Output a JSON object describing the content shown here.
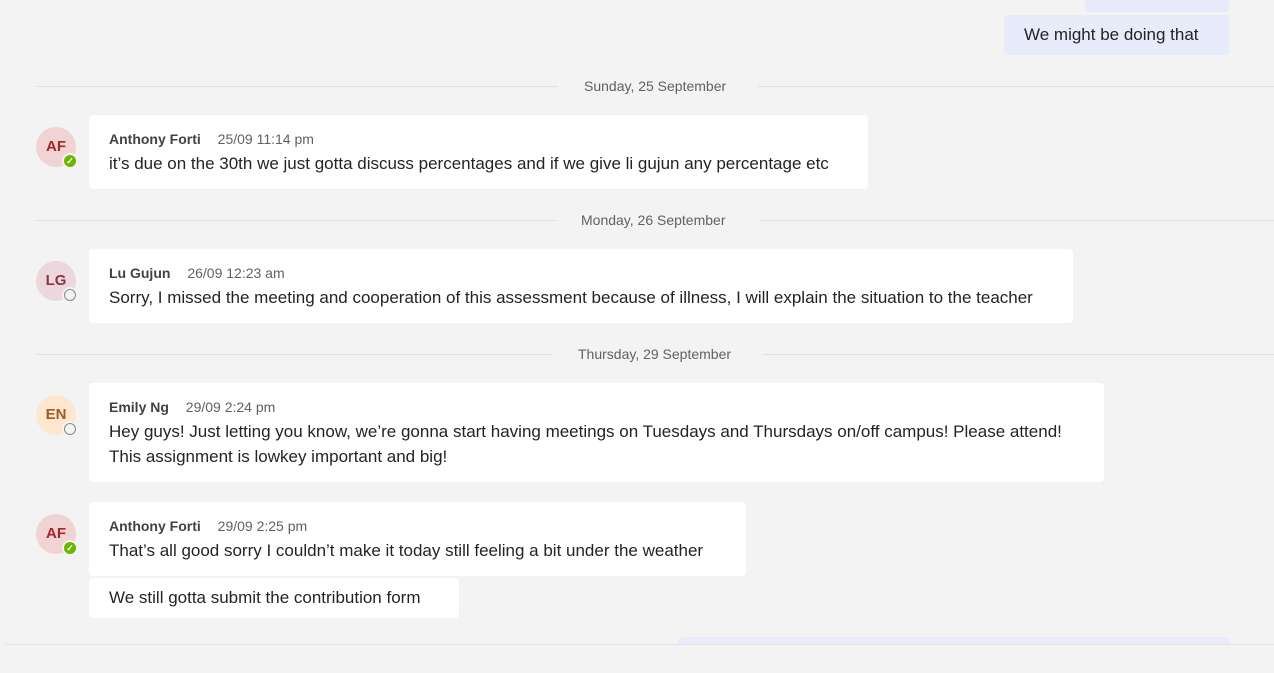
{
  "own_messages": {
    "top_message": "We might be doing that"
  },
  "date_dividers": [
    "Sunday, 25 September",
    "Monday, 26 September",
    "Thursday, 29 September"
  ],
  "messages": [
    {
      "initials": "AF",
      "author": "Anthony Forti",
      "timestamp": "25/09 11:14 pm",
      "status": "available",
      "lines": [
        "it’s due on the 30th we just gotta discuss percentages and if we give li gujun any percentage etc"
      ]
    },
    {
      "initials": "LG",
      "author": "Lu Gujun",
      "timestamp": "26/09 12:23 am",
      "status": "offline",
      "lines": [
        "Sorry, I missed the meeting and cooperation of this assessment because of illness, I will explain the situation to the teacher"
      ]
    },
    {
      "initials": "EN",
      "author": "Emily Ng",
      "timestamp": "29/09 2:24 pm",
      "status": "offline",
      "lines": [
        "Hey guys! Just letting you know, we’re gonna start having meetings on Tuesdays and Thursdays on/off campus! Please attend!",
        "This assignment is lowkey important and big!"
      ]
    },
    {
      "initials": "AF",
      "author": "Anthony Forti",
      "timestamp": "29/09 2:25 pm",
      "status": "available",
      "lines": [
        "That’s all good sorry I couldn’t make it today still feeling a bit under the weather"
      ],
      "followup": "We still gotta submit the contribution form"
    }
  ],
  "colors": {
    "background": "#f3f3f3",
    "bubble_other": "#ffffff",
    "bubble_self": "#e8ebfa",
    "status_available": "#6bb700",
    "avatar_af_bg": "#f1d3d3",
    "avatar_af_fg": "#a4262c",
    "avatar_lg_bg": "#ecd7dc",
    "avatar_lg_fg": "#8a3547",
    "avatar_en_bg": "#fde7cf",
    "avatar_en_fg": "#a45a1c"
  }
}
